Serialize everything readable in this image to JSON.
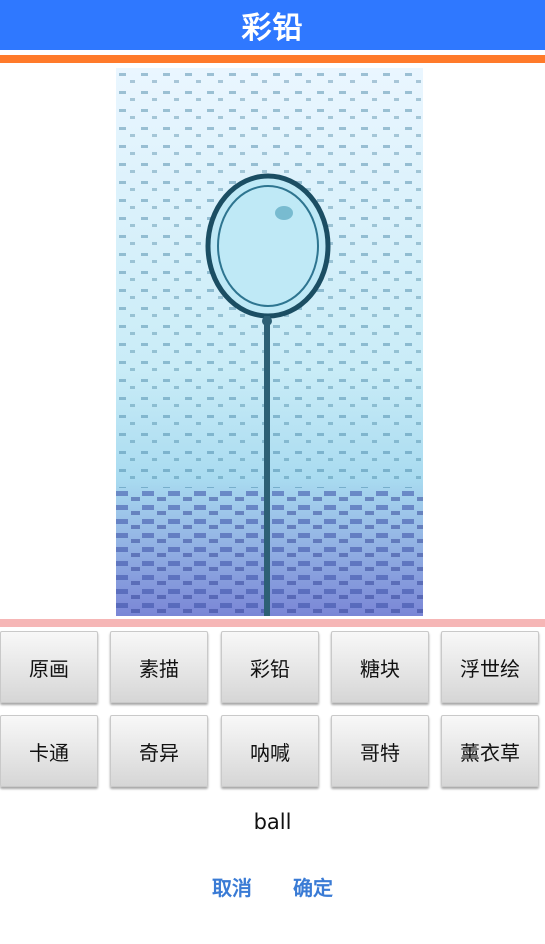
{
  "header": {
    "title": "彩铅"
  },
  "filters": {
    "row1": [
      "原画",
      "素描",
      "彩铅",
      "糖块",
      "浮世绘"
    ],
    "row2": [
      "卡通",
      "奇异",
      "呐喊",
      "哥特",
      "薰衣草"
    ]
  },
  "caption": "ball",
  "actions": {
    "cancel_label": "取消",
    "confirm_label": "确定"
  },
  "colors": {
    "titlebar": "#2f78ff",
    "accent_rule": "#ff7a2a",
    "divider": "#f6b6b6",
    "action_link": "#3a7bd5"
  }
}
